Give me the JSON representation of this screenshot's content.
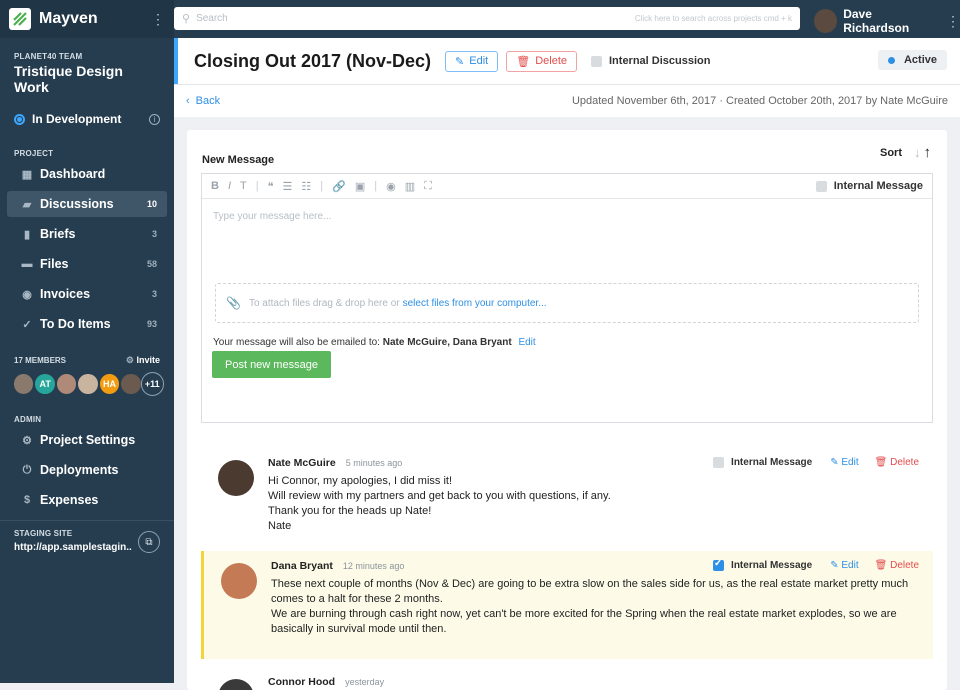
{
  "app": {
    "name": "Mayven"
  },
  "team": {
    "label": "PLANET40 TEAM",
    "name": "Tristique Design Work",
    "status": "In Development"
  },
  "project": {
    "label": "PROJECT",
    "items": [
      {
        "label": "Dashboard",
        "count": ""
      },
      {
        "label": "Discussions",
        "count": "10"
      },
      {
        "label": "Briefs",
        "count": "3"
      },
      {
        "label": "Files",
        "count": "58"
      },
      {
        "label": "Invoices",
        "count": "3"
      },
      {
        "label": "To Do Items",
        "count": "93"
      }
    ]
  },
  "members": {
    "label": "17 MEMBERS",
    "invite": "Invite",
    "initials": [
      "AT",
      "HA"
    ],
    "more": "+11"
  },
  "admin": {
    "label": "ADMIN",
    "items": [
      {
        "label": "Project Settings"
      },
      {
        "label": "Deployments"
      },
      {
        "label": "Expenses"
      }
    ]
  },
  "staging": {
    "label": "STAGING SITE",
    "url": "http://app.samplestagin..."
  },
  "search": {
    "placeholder": "Search",
    "hint": "Click here to search across projects  cmd + k"
  },
  "user": {
    "name": "Dave Richardson"
  },
  "header": {
    "title": "Closing Out 2017 (Nov-Dec)",
    "edit": "Edit",
    "delete": "Delete",
    "internal": "Internal Discussion",
    "status": "Active"
  },
  "subbar": {
    "back": "Back",
    "meta": "Updated November 6th, 2017  ·  Created October 20th, 2017 by  Nate McGuire"
  },
  "composer": {
    "label": "New Message",
    "sort": "Sort",
    "internal": "Internal Message",
    "placeholder": "Type your message here...",
    "attach_text": "To attach files drag & drop here or",
    "attach_link": "select files from your computer...",
    "email_text": "Your message will also be emailed to:",
    "email_recipients": "Nate McGuire, Dana Bryant",
    "email_edit": "Edit",
    "post": "Post new message"
  },
  "messages": [
    {
      "author": "Nate McGuire",
      "time": "5 minutes ago",
      "internal": "Internal Message",
      "edit": "Edit",
      "delete": "Delete",
      "lines": [
        "Hi Connor, my apologies, I did miss it!",
        "Will review with my partners and get back to you with questions, if any.",
        "Thank you for the heads up Nate!",
        "Nate"
      ]
    },
    {
      "author": "Dana Bryant",
      "time": "12 minutes ago",
      "internal": "Internal Message",
      "edit": "Edit",
      "delete": "Delete",
      "lines": [
        "These next couple of months (Nov & Dec) are going to be extra slow on the sales side for us, as the real estate market pretty much comes to a halt for these 2 months.",
        "We are burning through cash right now, yet can't be more excited for the Spring when the real estate market explodes, so we are basically in survival mode until then."
      ]
    },
    {
      "author": "Connor Hood",
      "time": "yesterday"
    }
  ]
}
